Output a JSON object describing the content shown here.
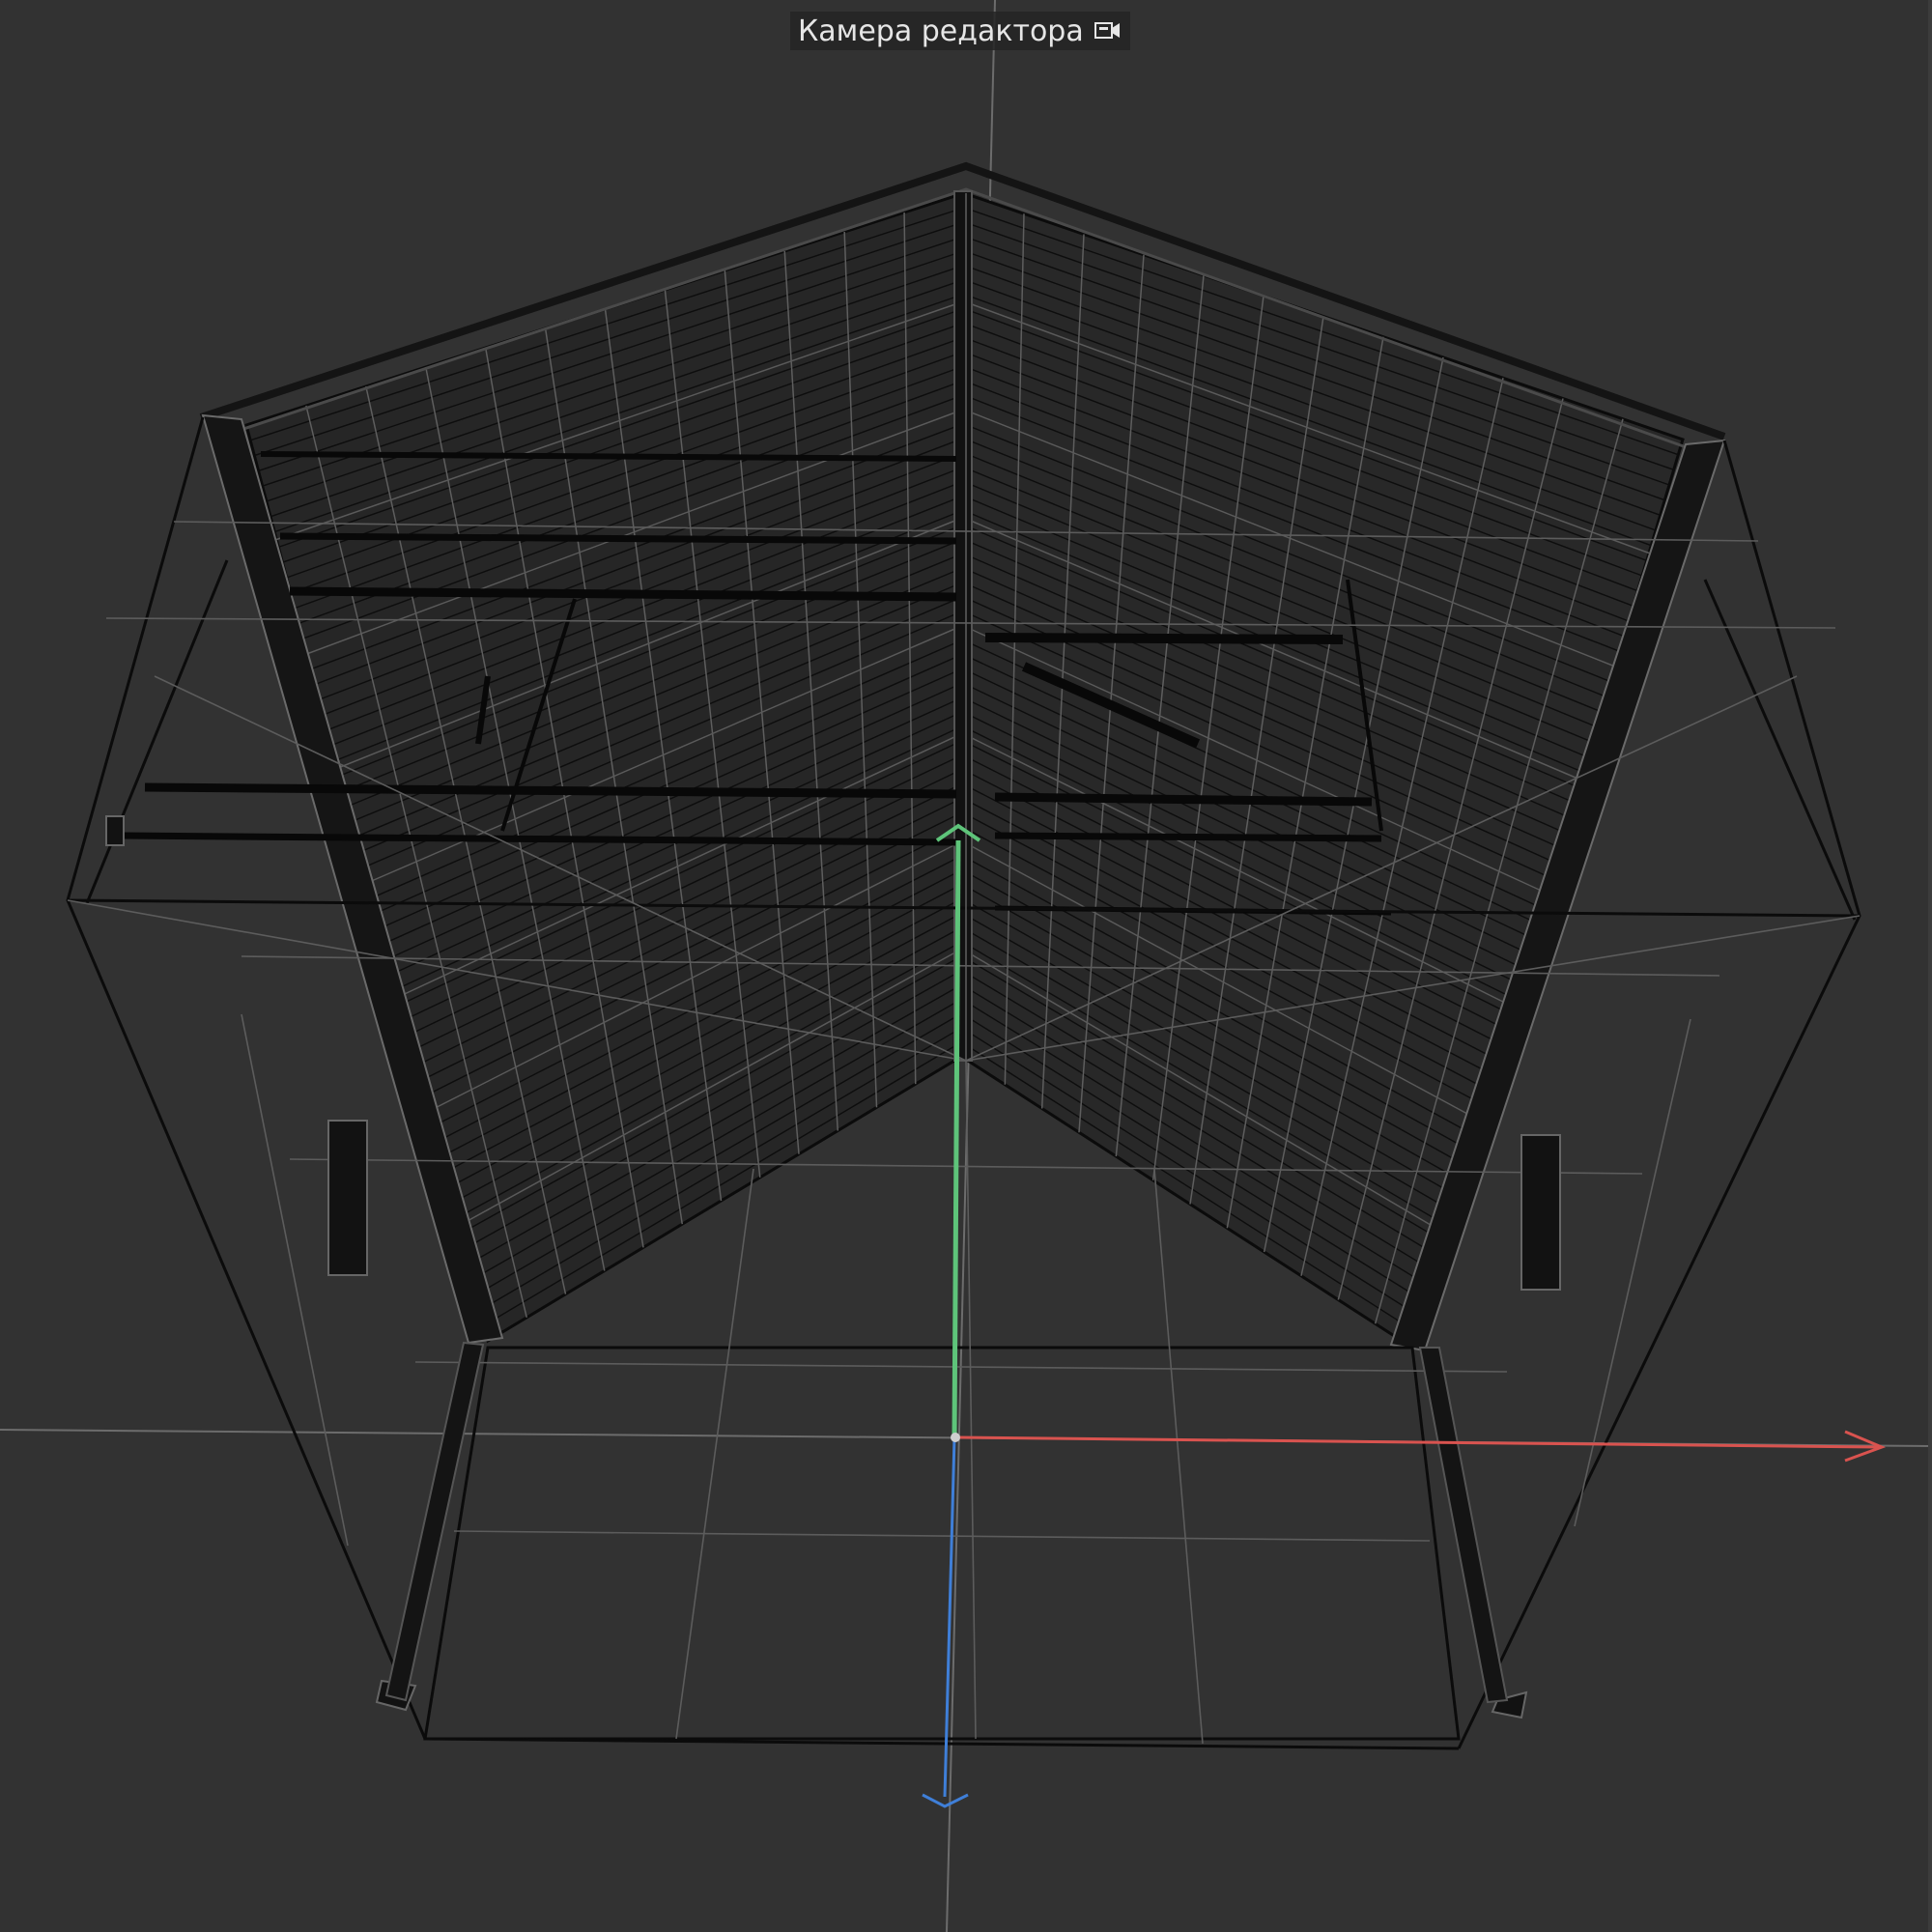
{
  "viewport": {
    "camera_label": "Камера редактора",
    "camera_icon": "camera-icon"
  },
  "axes": {
    "x": {
      "color": "#d9534f"
    },
    "y": {
      "color": "#5ec47a"
    },
    "z": {
      "color": "#3f7fd8"
    }
  },
  "colors": {
    "background": "#323232",
    "wire_dark": "#0b0b0b",
    "wire_light": "#6a6a6a",
    "origin_line": "#777777"
  }
}
